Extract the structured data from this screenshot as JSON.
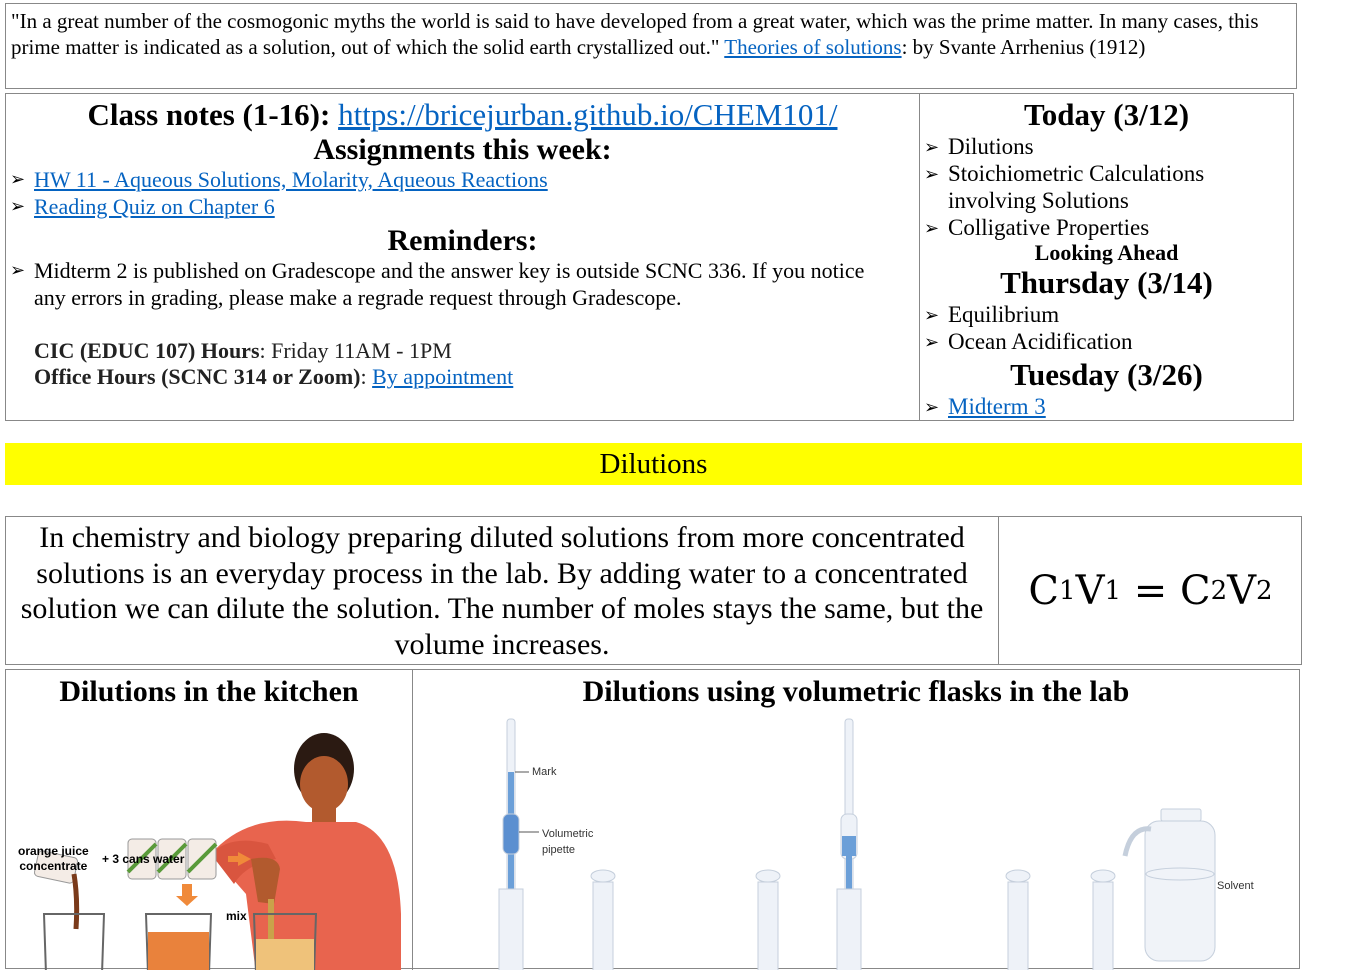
{
  "quote": {
    "text": "\"In a great number of the cosmogonic myths the world is said to have developed from a great water, which was the prime matter. In many cases, this prime matter is indicated as a solution, out of which the solid earth crystallized out.\" ",
    "link_text": "Theories of solutions",
    "suffix": ": by Svante Arrhenius (1912)"
  },
  "notes": {
    "class_notes_label": "Class notes (1-16): ",
    "class_notes_link": "https://bricejurban.github.io/CHEM101/",
    "assignments_heading": "Assignments this week:",
    "assignments": [
      "HW 11 - Aqueous Solutions, Molarity, Aqueous Reactions",
      "Reading Quiz on Chapter 6"
    ],
    "reminders_heading": "Reminders:",
    "reminders": [
      "Midterm 2 is published on Gradescope and the answer key is outside SCNC 336. If you notice any errors in grading, please make a regrade request through Gradescope."
    ],
    "cic_label": "CIC (EDUC 107) Hours",
    "cic_value": ": Friday 11AM - 1PM",
    "office_label": "Office Hours (SCNC 314 or Zoom)",
    "office_sep": ": ",
    "office_link": "By appointment"
  },
  "schedule": {
    "today_heading": "Today (3/12)",
    "today_items": [
      "Dilutions",
      "Stoichiometric Calculations involving Solutions",
      "Colligative Properties"
    ],
    "looking_ahead": "Looking Ahead",
    "thursday_heading": "Thursday (3/14)",
    "thursday_items": [
      "Equilibrium",
      "Ocean Acidification"
    ],
    "tuesday_heading": "Tuesday (3/26)",
    "tuesday_link": "Midterm 3"
  },
  "banner": {
    "title": "Dilutions",
    "color": "#ffff00"
  },
  "intro": {
    "text": "In chemistry and biology preparing diluted solutions from more concentrated solutions is an everyday process in the lab. By adding water to a concentrated solution we can dilute the solution. The number of moles stays the same, but the volume increases.",
    "equation": {
      "c1": "C",
      "s1": "1",
      "v1": "V",
      "s2": "1",
      "eq": " = ",
      "c2": "C",
      "s3": "2",
      "v2": "V",
      "s4": "2"
    }
  },
  "figures": {
    "kitchen_title": "Dilutions in the kitchen",
    "kitchen_labels": {
      "oj": "orange juice",
      "oj2": "concentrate",
      "plus": "+ 3 cans water",
      "mix": "mix"
    },
    "lab_title": "Dilutions using volumetric flasks in the lab",
    "lab_labels": {
      "mark": "Mark",
      "pipette1": "Volumetric",
      "pipette2": "pipette",
      "solvent": "Solvent"
    }
  }
}
